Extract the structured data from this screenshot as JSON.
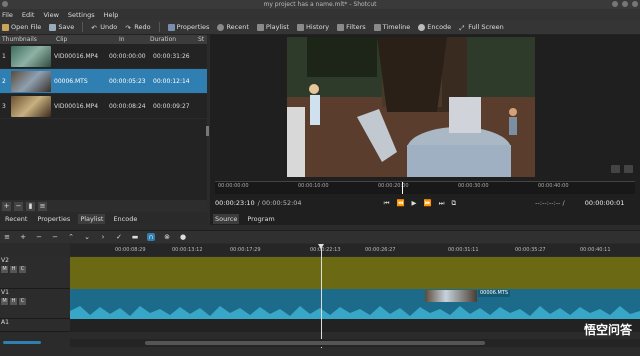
{
  "window": {
    "title": "my project has a name.mlt* - Shotcut"
  },
  "menu": [
    "File",
    "Edit",
    "View",
    "Settings",
    "Help"
  ],
  "toolbar": [
    "Open File",
    "Save",
    "Undo",
    "Redo",
    "Properties",
    "Recent",
    "Playlist",
    "History",
    "Filters",
    "Timeline",
    "Encode",
    "Full Screen"
  ],
  "playlist": {
    "headers": [
      "Thumbnails",
      "Clip",
      "In",
      "Duration",
      "St"
    ],
    "rows": [
      {
        "num": "1",
        "clip": "VID00016.MP4",
        "in": "00:00:00:00",
        "duration": "00:00:31:26",
        "selected": false
      },
      {
        "num": "2",
        "clip": "00006.MTS",
        "in": "00:00:05:23",
        "duration": "00:00:12:14",
        "selected": true
      },
      {
        "num": "3",
        "clip": "VID00016.MP4",
        "in": "00:00:08:24",
        "duration": "00:00:09:27",
        "selected": false
      }
    ],
    "tools": [
      "+",
      "−",
      "▮",
      "≡"
    ],
    "tabs": [
      "Recent",
      "Properties",
      "Playlist",
      "Encode"
    ]
  },
  "viewer": {
    "ruler": [
      "00:00:00:00",
      "00:00:10:00",
      "00:00:20:00",
      "00:00:30:00",
      "00:00:40:00"
    ],
    "position": "00:00:23:10",
    "duration": "/ 00:00:52:04",
    "in_point": "--:--:--:-- /",
    "out_point": "00:00:00:01",
    "tabs": [
      "Source",
      "Program"
    ]
  },
  "timeline": {
    "ruler": [
      "00:00:08:29",
      "00:00:13:12",
      "00:00:17:29",
      "00:00:22:13",
      "00:00:26:27",
      "00:00:31:11",
      "00:00:35:27",
      "00:00:40:11"
    ],
    "tracks": [
      {
        "name": "V2",
        "buttons": [
          "M",
          "H",
          "C"
        ]
      },
      {
        "name": "V1",
        "buttons": [
          "M",
          "H",
          "C"
        ]
      },
      {
        "name": "A1",
        "buttons": []
      }
    ],
    "clip_label": "00006.MTS"
  },
  "watermark": "悟空问答",
  "colors": {
    "selection": "#2f7fb3",
    "video_track": "#6c6914",
    "v1_track": "#1d6b8a",
    "waveform": "#38a6c6"
  }
}
